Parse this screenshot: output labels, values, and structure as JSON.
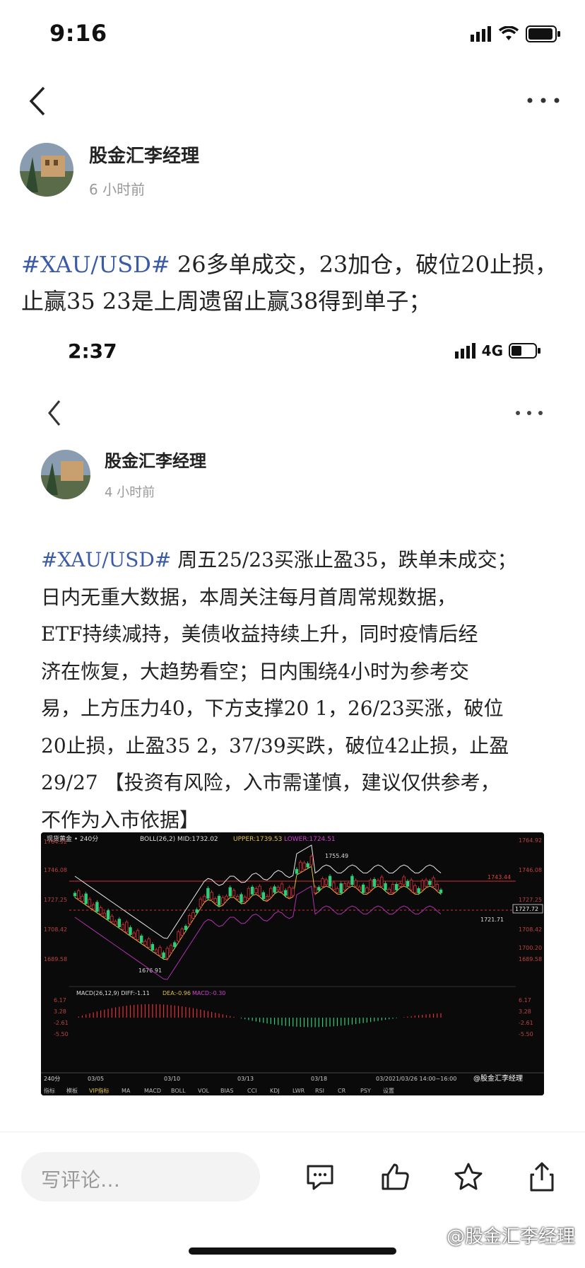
{
  "status_bar": {
    "time": "9:16"
  },
  "post": {
    "author": "股金汇李经理",
    "time_ago": "6 小时前",
    "hashtag": "#XAU/USD#",
    "line1": " 26多单成交，23加仓，破位20止损，",
    "line2": "止赢35 23是上周遗留止赢38得到单子；"
  },
  "embedded": {
    "status_time": "2:37",
    "network": "4G",
    "author": "股金汇李经理",
    "time_ago": "4 小时前",
    "hashtag": "#XAU/USD#",
    "lines": [
      " 周五25/23买涨止盈35，跌单未成交；",
      "日内无重大数据，本周关注每月首周常规数据，",
      "ETF持续减持，美债收益持续上升，同时疫情后经",
      "济在恢复，大趋势看空；日内围绕4小时为参考交",
      "易，上方压力40，下方支撑20 1，26/23买涨，破位",
      "20止损，止盈35 2，37/39买跌，破位42止损，止盈",
      "29/27 【投资有风险，入市需谨慎，建议仅供参考，",
      "不作为入市依据】"
    ]
  },
  "chart": {
    "header": "现货黄金 • 240分",
    "boll": "BOLL(26,2) MID:1732.02",
    "upper": "UPPER:1739.53",
    "lower": "LOWER:1724.51",
    "macd_label": "MACD(26,12,9) DIFF:-1.11",
    "dea": "DEA:-0.96",
    "macd_val": "MACD:-0.30",
    "period": "240分",
    "date_range": "03/2021/03/26 14:00~16:00",
    "watermark": "@股金汇李经理",
    "high_label": "1755.49",
    "low_label": "1676.91",
    "last_label": "1721.71",
    "price_tag": "1727.72",
    "level_tag": "1743.44",
    "y_ticks_left": [
      "1764.92",
      "1746.08",
      "1727.25",
      "1708.42",
      "1689.58"
    ],
    "y_ticks_right": [
      "1764.92",
      "1746.08",
      "1727.25",
      "1708.42",
      "1700.20",
      "1689.58"
    ],
    "macd_ticks": [
      "6.17",
      "3.28",
      "-2.61",
      "-5.50"
    ],
    "x_ticks": [
      "03/05",
      "03/10",
      "03/13",
      "03/18"
    ],
    "tabs": [
      "指标",
      "模板",
      "VIP指标",
      "MA",
      "MACD",
      "BOLL",
      "VOL",
      "BIAS",
      "CCI",
      "KDJ",
      "LWR",
      "RSI",
      "CR",
      "PSY",
      "设置"
    ]
  },
  "bottom_bar": {
    "comment_placeholder": "写评论…"
  },
  "watermark": "@股金汇李经理",
  "colors": {
    "hashtag": "#3b5ba5",
    "up": "#e0303a",
    "down": "#2fcf7a"
  }
}
